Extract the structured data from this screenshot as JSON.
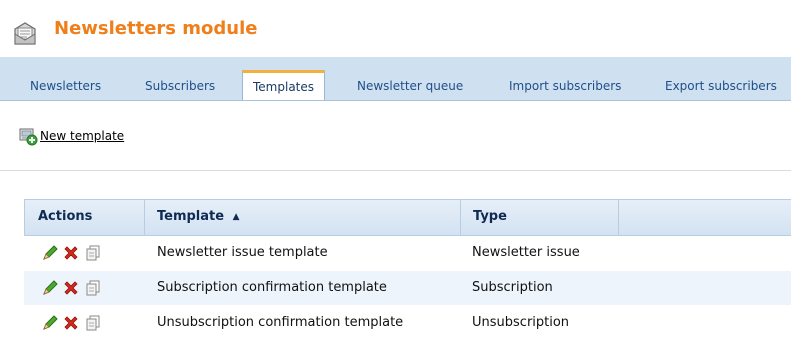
{
  "header": {
    "title": "Newsletters module",
    "icon": "newsletter-module-icon"
  },
  "tabs": [
    {
      "label": "Newsletters",
      "active": false
    },
    {
      "label": "Subscribers",
      "active": false
    },
    {
      "label": "Templates",
      "active": true
    },
    {
      "label": "Newsletter queue",
      "active": false
    },
    {
      "label": "Import subscribers",
      "active": false
    },
    {
      "label": "Export subscribers",
      "active": false
    }
  ],
  "toolbar": {
    "new_template_label": "New template",
    "new_template_icon": "new-template-icon"
  },
  "grid": {
    "columns": [
      "Actions",
      "Template",
      "Type"
    ],
    "sort_indicator": "▲",
    "rows": [
      {
        "template": "Newsletter issue template",
        "type": "Newsletter issue"
      },
      {
        "template": "Subscription confirmation template",
        "type": "Subscription"
      },
      {
        "template": "Unsubscription confirmation template",
        "type": "Unsubscription"
      }
    ],
    "row_actions": [
      "edit-icon",
      "delete-icon",
      "clone-icon"
    ]
  },
  "colors": {
    "accent": "#ef7f1a",
    "tab_bar": "#cfe0f1",
    "tab_active_border": "#f2b13d",
    "grid_header": "#d3e2f2",
    "row_alt": "#eef4fb"
  }
}
